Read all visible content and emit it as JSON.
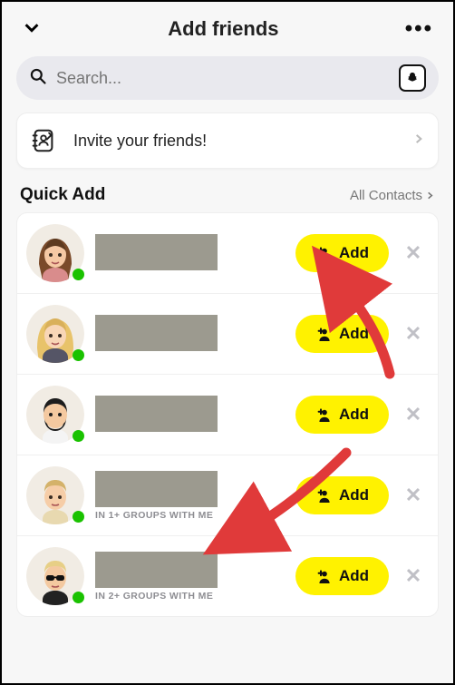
{
  "header": {
    "title": "Add friends"
  },
  "search": {
    "placeholder": "Search..."
  },
  "invite": {
    "label": "Invite your friends!"
  },
  "section": {
    "title": "Quick Add",
    "all_label": "All Contacts"
  },
  "add_label": "Add",
  "rows": [
    {
      "sub": ""
    },
    {
      "sub": ""
    },
    {
      "sub": ""
    },
    {
      "sub": "IN 1+ GROUPS WITH ME"
    },
    {
      "sub": "IN 2+ GROUPS WITH ME"
    }
  ]
}
